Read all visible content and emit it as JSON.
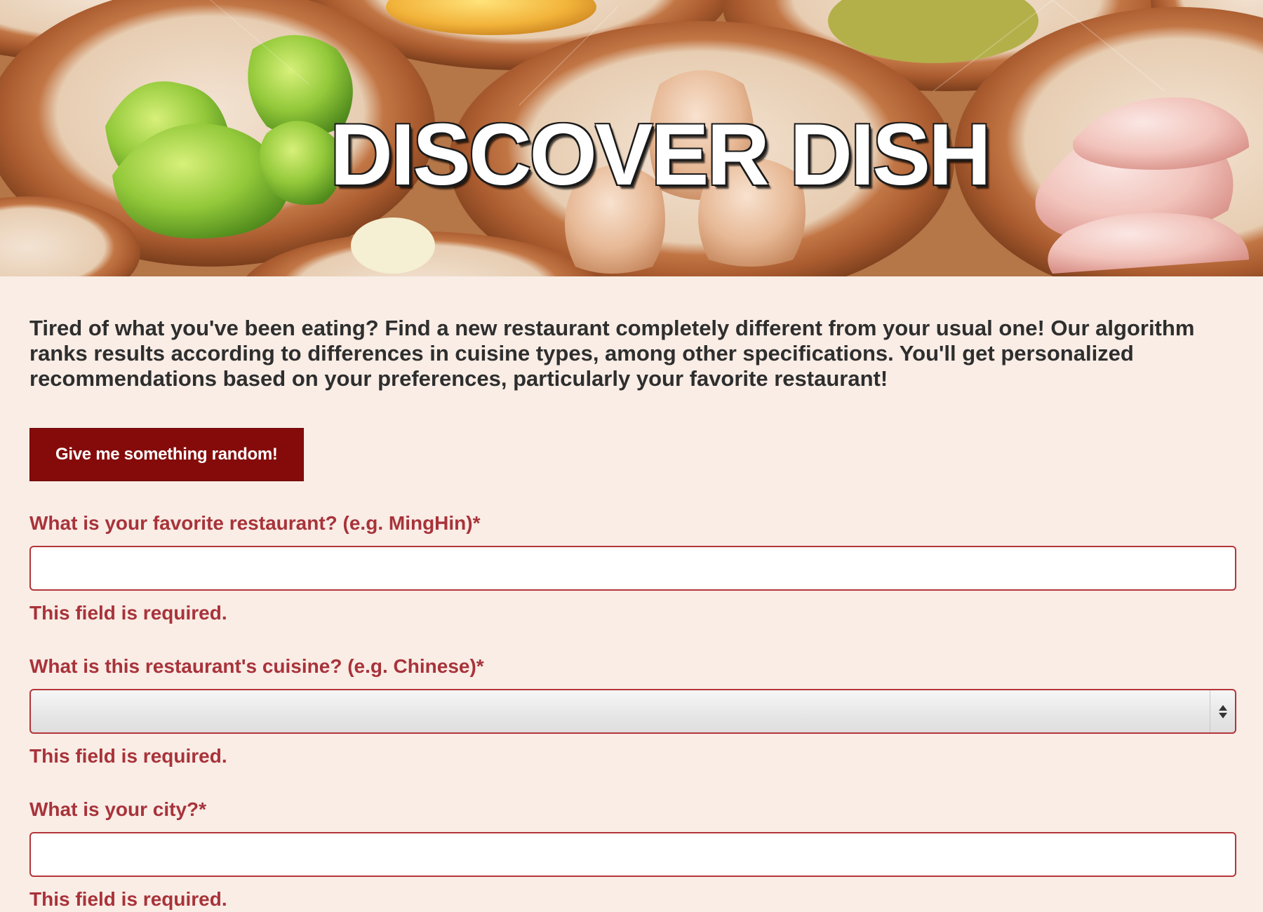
{
  "hero": {
    "title": "DISCOVER DISH",
    "image": "dim-sum-bamboo-steamers"
  },
  "intro": {
    "text": "Tired of what you've been eating? Find a new restaurant completely different from your usual one! Our algorithm ranks results according to differences in cuisine types, among other specifications. You'll get personalized recommendations based on your preferences, particularly your favorite restaurant!"
  },
  "random_button": {
    "label": "Give me something random!"
  },
  "form": {
    "favorite": {
      "label": "What is your favorite restaurant? (e.g. MingHin)*",
      "value": "",
      "error": "This field is required."
    },
    "cuisine": {
      "label": "What is this restaurant's cuisine? (e.g. Chinese)*",
      "selected": "",
      "error": "This field is required."
    },
    "city": {
      "label": "What is your city?*",
      "value": "",
      "error": "This field is required."
    }
  },
  "colors": {
    "background": "#f9ede6",
    "accent": "#850b0b",
    "label": "#a8333a",
    "text": "#2e2e2e"
  }
}
